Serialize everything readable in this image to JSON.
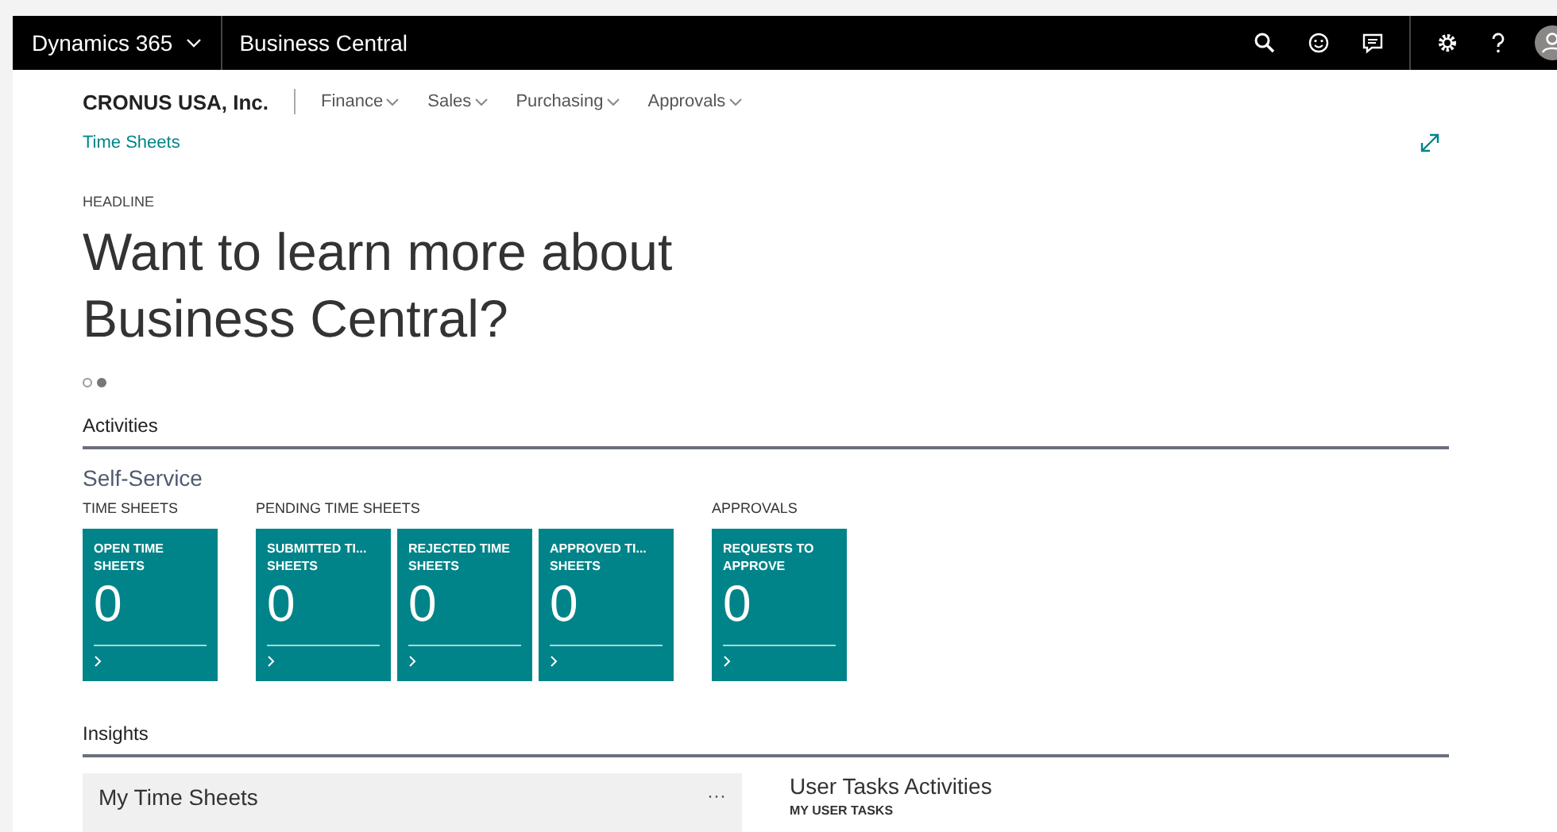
{
  "top_bar": {
    "product": "Dynamics 365",
    "app": "Business Central"
  },
  "nav": {
    "company": "CRONUS USA, Inc.",
    "menus": [
      "Finance",
      "Sales",
      "Purchasing",
      "Approvals"
    ],
    "link": "Time Sheets"
  },
  "headline": {
    "label": "HEADLINE",
    "text": "Want to learn more about Business Central?",
    "carousel_dots": [
      {
        "selected": false
      },
      {
        "selected": true
      }
    ]
  },
  "activities": {
    "title": "Activities",
    "subtitle": "Self-Service",
    "groups": [
      {
        "label": "TIME SHEETS",
        "tiles": [
          {
            "label": "OPEN TIME SHEETS",
            "value": "0"
          }
        ]
      },
      {
        "label": "PENDING TIME SHEETS",
        "tiles": [
          {
            "label": "SUBMITTED TI... SHEETS",
            "value": "0"
          },
          {
            "label": "REJECTED TIME SHEETS",
            "value": "0"
          },
          {
            "label": "APPROVED TI... SHEETS",
            "value": "0"
          }
        ]
      },
      {
        "label": "APPROVALS",
        "tiles": [
          {
            "label": "REQUESTS TO APPROVE",
            "value": "0"
          }
        ]
      }
    ]
  },
  "insights": {
    "title": "Insights",
    "card_title": "My Time Sheets",
    "more": "···",
    "side_title": "User Tasks Activities",
    "side_label": "MY USER TASKS"
  }
}
